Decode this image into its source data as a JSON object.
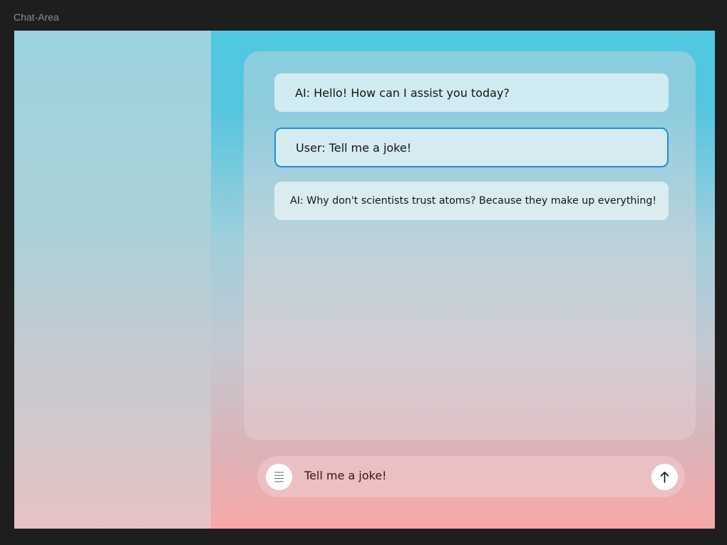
{
  "frame": {
    "label": "Chat-Area"
  },
  "messages": [
    {
      "text": "AI: Hello! How can I assist you today?"
    },
    {
      "text": "User: Tell me a joke!"
    },
    {
      "text": "AI: Why don't scientists trust atoms? Because they make up everything!"
    }
  ],
  "input": {
    "value": "Tell me a joke!",
    "menu_icon": "menu-icon",
    "send_icon": "arrow-up-icon"
  },
  "colors": {
    "selection_border": "#1a8fe0",
    "background": "#1e1e1e"
  }
}
